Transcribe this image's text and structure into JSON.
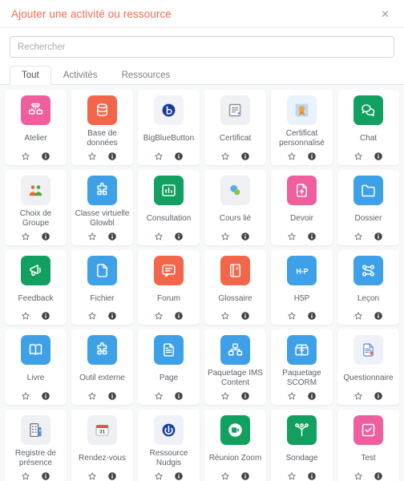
{
  "header": {
    "title": "Ajouter une activité ou ressource",
    "close_label": "✕",
    "title_color": "#f66b4e"
  },
  "search": {
    "placeholder": "Rechercher",
    "value": ""
  },
  "tabs": [
    {
      "label": "Tout",
      "active": true
    },
    {
      "label": "Activités",
      "active": false
    },
    {
      "label": "Ressources",
      "active": false
    }
  ],
  "card_actions": {
    "favorite_name": "star-icon",
    "info_name": "info-icon"
  },
  "items": [
    {
      "label": "Atelier",
      "icon": "workshop-icon",
      "bg": "#ef5f9e",
      "fg": "#ffffff"
    },
    {
      "label": "Base de données",
      "icon": "database-icon",
      "bg": "#f4664a",
      "fg": "#ffffff"
    },
    {
      "label": "BigBlueButton",
      "icon": "bigbluebutton-icon",
      "bg": "#f1f3f6",
      "fg": "#16399d"
    },
    {
      "label": "Certificat",
      "icon": "certificate-icon",
      "bg": "#eef0f3",
      "fg": "#8a9099"
    },
    {
      "label": "Certificat personnalisé",
      "icon": "custom-certificate-icon",
      "bg": "#eaf2fb",
      "fg": "#f0a93c"
    },
    {
      "label": "Chat",
      "icon": "chat-icon",
      "bg": "#11a05f",
      "fg": "#ffffff"
    },
    {
      "label": "Choix de Groupe",
      "icon": "group-choice-icon",
      "bg": "#eef0f3",
      "fg": "#e8692e"
    },
    {
      "label": "Classe virtuelle Glowbl",
      "icon": "puzzle-icon",
      "bg": "#3ea1e8",
      "fg": "#ffffff"
    },
    {
      "label": "Consultation",
      "icon": "bar-chart-icon",
      "bg": "#11a05f",
      "fg": "#ffffff"
    },
    {
      "label": "Cours lié",
      "icon": "linked-course-icon",
      "bg": "#eef0f3",
      "fg": "#5aa9e6"
    },
    {
      "label": "Devoir",
      "icon": "assignment-icon",
      "bg": "#ef5f9e",
      "fg": "#ffffff"
    },
    {
      "label": "Dossier",
      "icon": "folder-icon",
      "bg": "#3ea1e8",
      "fg": "#ffffff"
    },
    {
      "label": "Feedback",
      "icon": "megaphone-icon",
      "bg": "#11a05f",
      "fg": "#ffffff"
    },
    {
      "label": "Fichier",
      "icon": "file-icon",
      "bg": "#3ea1e8",
      "fg": "#ffffff"
    },
    {
      "label": "Forum",
      "icon": "forum-icon",
      "bg": "#f4664a",
      "fg": "#ffffff"
    },
    {
      "label": "Glossaire",
      "icon": "glossary-icon",
      "bg": "#f4664a",
      "fg": "#ffffff"
    },
    {
      "label": "H5P",
      "icon": "h5p-icon",
      "bg": "#3ea1e8",
      "fg": "#ffffff"
    },
    {
      "label": "Leçon",
      "icon": "lesson-icon",
      "bg": "#3ea1e8",
      "fg": "#ffffff"
    },
    {
      "label": "Livre",
      "icon": "book-icon",
      "bg": "#3ea1e8",
      "fg": "#ffffff"
    },
    {
      "label": "Outil externe",
      "icon": "puzzle-icon",
      "bg": "#3ea1e8",
      "fg": "#ffffff"
    },
    {
      "label": "Page",
      "icon": "page-icon",
      "bg": "#3ea1e8",
      "fg": "#ffffff"
    },
    {
      "label": "Paquetage IMS Content",
      "icon": "ims-package-icon",
      "bg": "#3ea1e8",
      "fg": "#ffffff"
    },
    {
      "label": "Paquetage SCORM",
      "icon": "scorm-package-icon",
      "bg": "#3ea1e8",
      "fg": "#ffffff"
    },
    {
      "label": "Questionnaire",
      "icon": "questionnaire-icon",
      "bg": "#eef2f8",
      "fg": "#6f8fd0"
    },
    {
      "label": "Registre de présence",
      "icon": "attendance-icon",
      "bg": "#eef0f3",
      "fg": "#6b7280"
    },
    {
      "label": "Rendez-vous",
      "icon": "calendar-icon",
      "bg": "#eef0f3",
      "fg": "#e04b43"
    },
    {
      "label": "Ressource Nudgis",
      "icon": "nudgis-icon",
      "bg": "#eef2f8",
      "fg": "#16399d"
    },
    {
      "label": "Réunion Zoom",
      "icon": "zoom-meeting-icon",
      "bg": "#11a05f",
      "fg": "#ffffff"
    },
    {
      "label": "Sondage",
      "icon": "survey-icon",
      "bg": "#11a05f",
      "fg": "#ffffff"
    },
    {
      "label": "Test",
      "icon": "quiz-icon",
      "bg": "#ef5f9e",
      "fg": "#ffffff"
    }
  ]
}
